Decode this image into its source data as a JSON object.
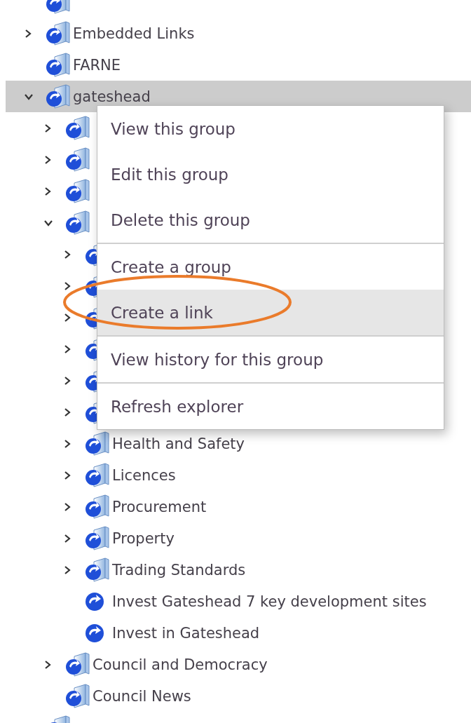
{
  "tree": [
    {
      "kind": "folder",
      "selected": false
    },
    {
      "kind": "folder",
      "label": "Embedded Links",
      "expanded": false,
      "selected": false
    },
    {
      "kind": "folder",
      "label": "FARNE",
      "selected": false
    },
    {
      "kind": "folder",
      "label": "gateshead",
      "expanded": true,
      "selected": true,
      "children": [
        {
          "kind": "folder",
          "expanded": false,
          "selected": false
        },
        {
          "kind": "folder",
          "expanded": false,
          "selected": false
        },
        {
          "kind": "folder",
          "expanded": false,
          "selected": false
        },
        {
          "kind": "folder",
          "expanded": true,
          "selected": false,
          "children": [
            {
              "kind": "folder",
              "expanded": false,
              "selected": false
            },
            {
              "kind": "folder",
              "expanded": false,
              "selected": false
            },
            {
              "kind": "folder",
              "expanded": false,
              "selected": false
            },
            {
              "kind": "folder",
              "expanded": false,
              "selected": false
            },
            {
              "kind": "folder",
              "expanded": false,
              "selected": false
            },
            {
              "kind": "folder",
              "expanded": false,
              "selected": false
            },
            {
              "kind": "folder",
              "label": "Health and Safety",
              "expanded": false,
              "selected": false
            },
            {
              "kind": "folder",
              "label": "Licences",
              "expanded": false,
              "selected": false
            },
            {
              "kind": "folder",
              "label": "Procurement",
              "expanded": false,
              "selected": false
            },
            {
              "kind": "folder",
              "label": "Property",
              "expanded": false,
              "selected": false
            },
            {
              "kind": "folder",
              "label": "Trading Standards",
              "expanded": false,
              "selected": false
            },
            {
              "kind": "link",
              "label": "Invest Gateshead 7 key development sites",
              "selected": false
            },
            {
              "kind": "link",
              "label": "Invest in Gateshead",
              "selected": false
            }
          ]
        },
        {
          "kind": "folder",
          "label": "Council and Democracy",
          "expanded": false,
          "selected": false
        },
        {
          "kind": "folder",
          "label": "Council News",
          "selected": false
        }
      ]
    },
    {
      "kind": "folder",
      "selected": false
    }
  ],
  "context_menu": {
    "sections": [
      [
        {
          "label": "View this group",
          "selected": false
        },
        {
          "label": "Edit this group",
          "selected": false
        },
        {
          "label": "Delete this group",
          "selected": false
        }
      ],
      [
        {
          "label": "Create a group",
          "selected": false
        },
        {
          "label": "Create a link",
          "selected": true
        }
      ],
      [
        {
          "label": "View history for this group",
          "selected": false
        }
      ],
      [
        {
          "label": "Refresh explorer",
          "selected": false
        }
      ]
    ]
  }
}
